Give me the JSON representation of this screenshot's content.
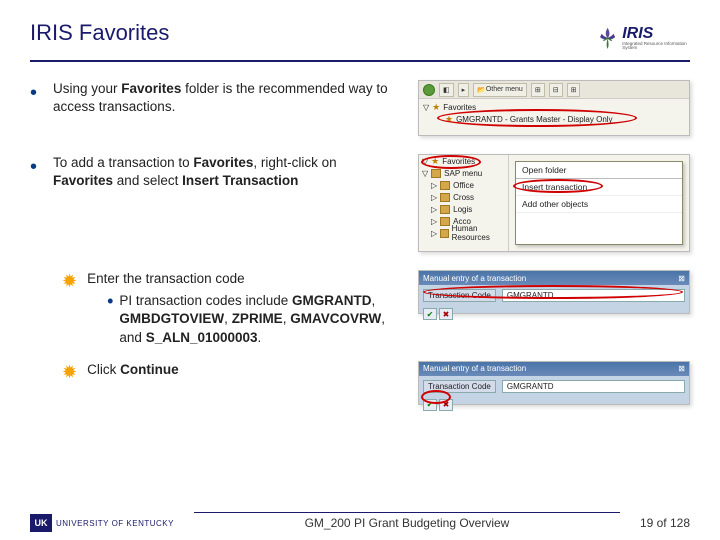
{
  "title": "IRIS Favorites",
  "logo": {
    "text": "IRIS",
    "sub": "Integrated Resource Information System"
  },
  "bullets": [
    {
      "text_parts": [
        "Using your ",
        "Favorites",
        " folder is the recommended way to access transactions."
      ]
    },
    {
      "text_parts": [
        "To add a transaction to ",
        "Favorites",
        ", right-click on ",
        "Favorites",
        " and select ",
        "Insert Transaction"
      ]
    }
  ],
  "sub_bullets": [
    {
      "lead": "Enter the transaction code",
      "inner": [
        "PI transaction codes include ",
        "GMGRANTD",
        ", ",
        "GMBDGTOVIEW",
        ", ",
        "ZPRIME",
        ", ",
        "GMAVCOVRW",
        ", and ",
        "S_ALN_01000003",
        "."
      ]
    },
    {
      "lead_parts": [
        "Click ",
        "Continue"
      ]
    }
  ],
  "shot1": {
    "other_menu": "Other menu",
    "favorites": "Favorites",
    "item": "GMGRANTD - Grants Master - Display Only"
  },
  "shot2": {
    "left_items": [
      "Favorites",
      "SAP menu",
      "Office",
      "Cross",
      "Logis",
      "Acco",
      "Human Resources"
    ],
    "menu": [
      "Open folder",
      "Insert transaction",
      "Add other objects"
    ]
  },
  "shot3": {
    "title": "Manual entry of a transaction",
    "label": "Transaction Code",
    "value": "GMGRANTD"
  },
  "footer": {
    "uk": "UNIVERSITY OF KENTUCKY",
    "uk_mark": "UK",
    "center": "GM_200 PI Grant Budgeting Overview",
    "page": "19 of 128"
  }
}
